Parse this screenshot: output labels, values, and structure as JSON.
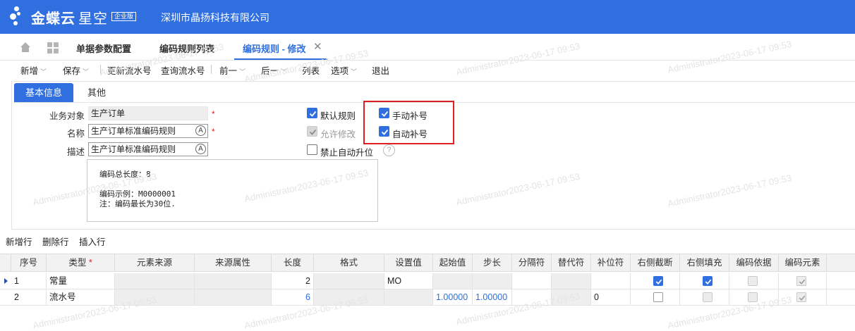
{
  "app": {
    "brand": "金蝶云",
    "brand_light": "星空",
    "edition": "企业版",
    "company": "深圳市晶扬科技有限公司"
  },
  "tabs": [
    {
      "label": "单据参数配置"
    },
    {
      "label": "编码规则列表"
    },
    {
      "label": "编码规则 - 修改",
      "active": true
    }
  ],
  "toolbar": {
    "new": "新增",
    "save": "保存",
    "update_serial": "更新流水号",
    "query_serial": "查询流水号",
    "prev": "前一",
    "next": "后一",
    "list": "列表",
    "options": "选项",
    "exit": "退出"
  },
  "form_tabs": {
    "basic": "基本信息",
    "other": "其他"
  },
  "form": {
    "business_object_label": "业务对象",
    "business_object_value": "生产订单",
    "name_label": "名称",
    "name_value": "生产订单标准编码规则",
    "desc_label": "描述",
    "desc_value": "生产订单标准编码规则",
    "required_mark": "*",
    "multilang_glyph": "A"
  },
  "options": {
    "default_rule": {
      "label": "默认规则",
      "checked": true
    },
    "allow_modify": {
      "label": "允许修改",
      "checked": true,
      "disabled": true
    },
    "disable_auto_increment": {
      "label": "禁止自动升位",
      "checked": false
    },
    "manual_pad": {
      "label": "手动补号",
      "checked": true
    },
    "auto_pad": {
      "label": "自动补号",
      "checked": true
    },
    "help_glyph": "?"
  },
  "info": {
    "total_length": "编码总长度：8",
    "example": "编码示例：M0000001",
    "note": "注：编码最长为30位."
  },
  "grid_toolbar": {
    "add_row": "新增行",
    "delete_row": "删除行",
    "insert_row": "插入行"
  },
  "grid": {
    "columns": [
      "序号",
      "类型",
      "元素来源",
      "来源属性",
      "长度",
      "格式",
      "设置值",
      "起始值",
      "步长",
      "分隔符",
      "替代符",
      "补位符",
      "右侧截断",
      "右侧填充",
      "编码依据",
      "编码元素"
    ],
    "required_star": "*",
    "rows": [
      {
        "seq": "1",
        "type": "常量",
        "length": "2",
        "value": "MO",
        "start": "",
        "step": "",
        "pad_char": "",
        "right_trunc": true,
        "right_fill": true,
        "code_basis": false,
        "code_element": true
      },
      {
        "seq": "2",
        "type": "流水号",
        "length": "6",
        "value": "",
        "start": "1.00000",
        "step": "1.00000",
        "pad_char": "0",
        "right_trunc": false,
        "right_fill": false,
        "code_basis": false,
        "code_element": true
      }
    ]
  },
  "watermark": "Administrator2023-06-17 09:53",
  "colors": {
    "accent": "#2f6fe0",
    "highlight_box": "#e02020"
  }
}
